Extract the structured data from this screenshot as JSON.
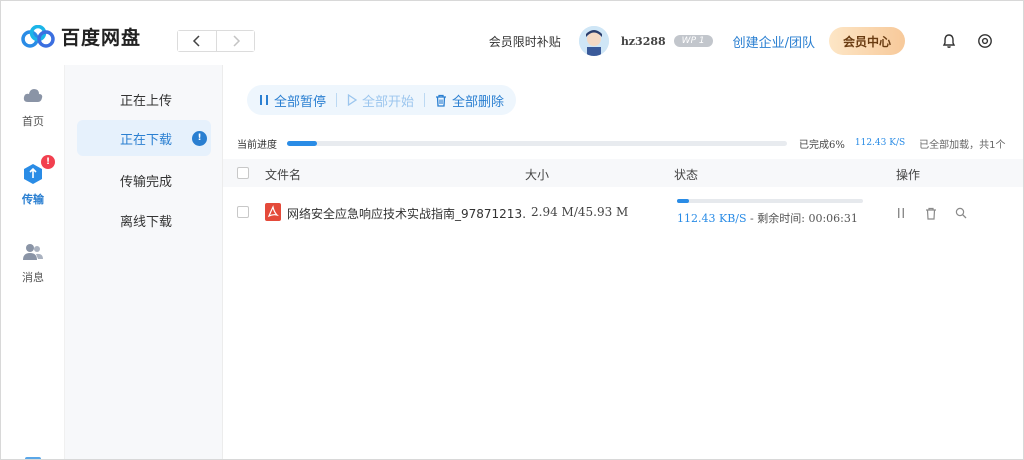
{
  "app": {
    "name": "百度网盘",
    "brand_color": "#2a7fd1"
  },
  "header": {
    "promo": "会员限时补贴",
    "username": "hz3288",
    "vip_label": "WP 1",
    "enterprise_link": "创建企业/团队",
    "member_center": "会员中心",
    "icons": [
      "back-arrow-icon",
      "forward-arrow-icon",
      "bell-icon",
      "settings-icon"
    ]
  },
  "rail": {
    "items": [
      {
        "label": "首页",
        "icon": "cloud-icon"
      },
      {
        "label": "传输",
        "icon": "transfer-icon",
        "badge": "!"
      },
      {
        "label": "消息",
        "icon": "people-icon"
      }
    ]
  },
  "subnav": {
    "items": [
      {
        "label": "正在上传"
      },
      {
        "label": "正在下载",
        "badge": "!"
      },
      {
        "label": "传输完成"
      },
      {
        "label": "离线下载"
      }
    ]
  },
  "toolbar": {
    "pause_all": "全部暂停",
    "start_all": "全部开始",
    "delete_all": "全部删除"
  },
  "progress": {
    "label": "当前进度",
    "percent": 6,
    "done_text": "已完成6%",
    "speed": "112.43 K/S",
    "loaded_text": "已全部加载，共1个"
  },
  "table": {
    "columns": {
      "name": "文件名",
      "size": "大小",
      "status": "状态",
      "actions": "操作"
    },
    "rows": [
      {
        "name": "网络安全应急响应技术实战指南_97871213…",
        "size": "2.94 M/45.93 M",
        "progress_fraction": 0.064,
        "speed": "112.43 KB/S",
        "remaining": " - 剩余时间: 00:06:31",
        "file_type": "pdf"
      }
    ]
  }
}
